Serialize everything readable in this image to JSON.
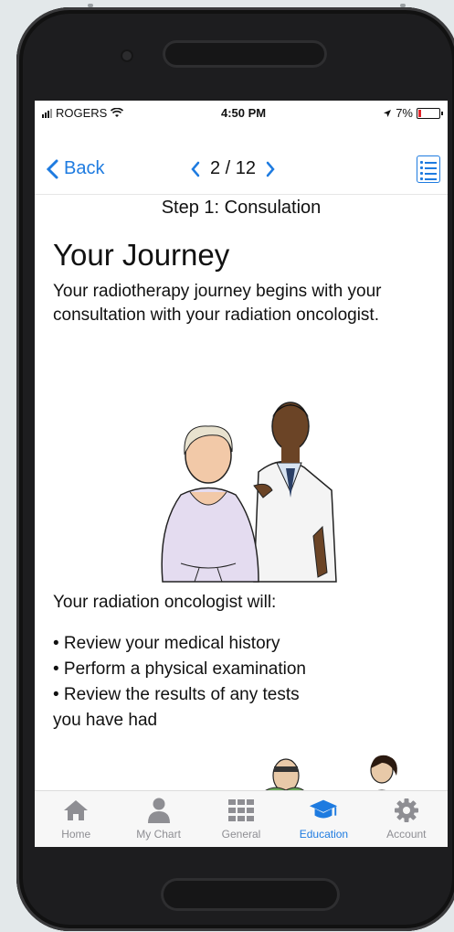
{
  "status_bar": {
    "carrier": "ROGERS",
    "time": "4:50 PM",
    "battery": "7%"
  },
  "nav": {
    "back_label": "Back",
    "page_indicator": "2 / 12"
  },
  "step_title": "Step 1: Consulation",
  "heading": "Your Journey",
  "intro_text": "Your radiotherapy journey begins with your consultation with your radiation oncologist.",
  "list_intro": "Your radiation oncologist will:",
  "bullets": [
    "• Review your medical history",
    "• Perform a physical examination",
    "• Review the results of any tests",
    "you have had"
  ],
  "tabs": [
    {
      "label": "Home",
      "icon": "home-icon"
    },
    {
      "label": "My Chart",
      "icon": "person-icon"
    },
    {
      "label": "General",
      "icon": "grid-icon"
    },
    {
      "label": "Education",
      "icon": "graduation-cap-icon",
      "active": true
    },
    {
      "label": "Account",
      "icon": "gear-icon"
    }
  ],
  "colors": {
    "accent": "#1e7be0",
    "inactive": "#8e8e93",
    "battery_low": "#e0242a"
  }
}
